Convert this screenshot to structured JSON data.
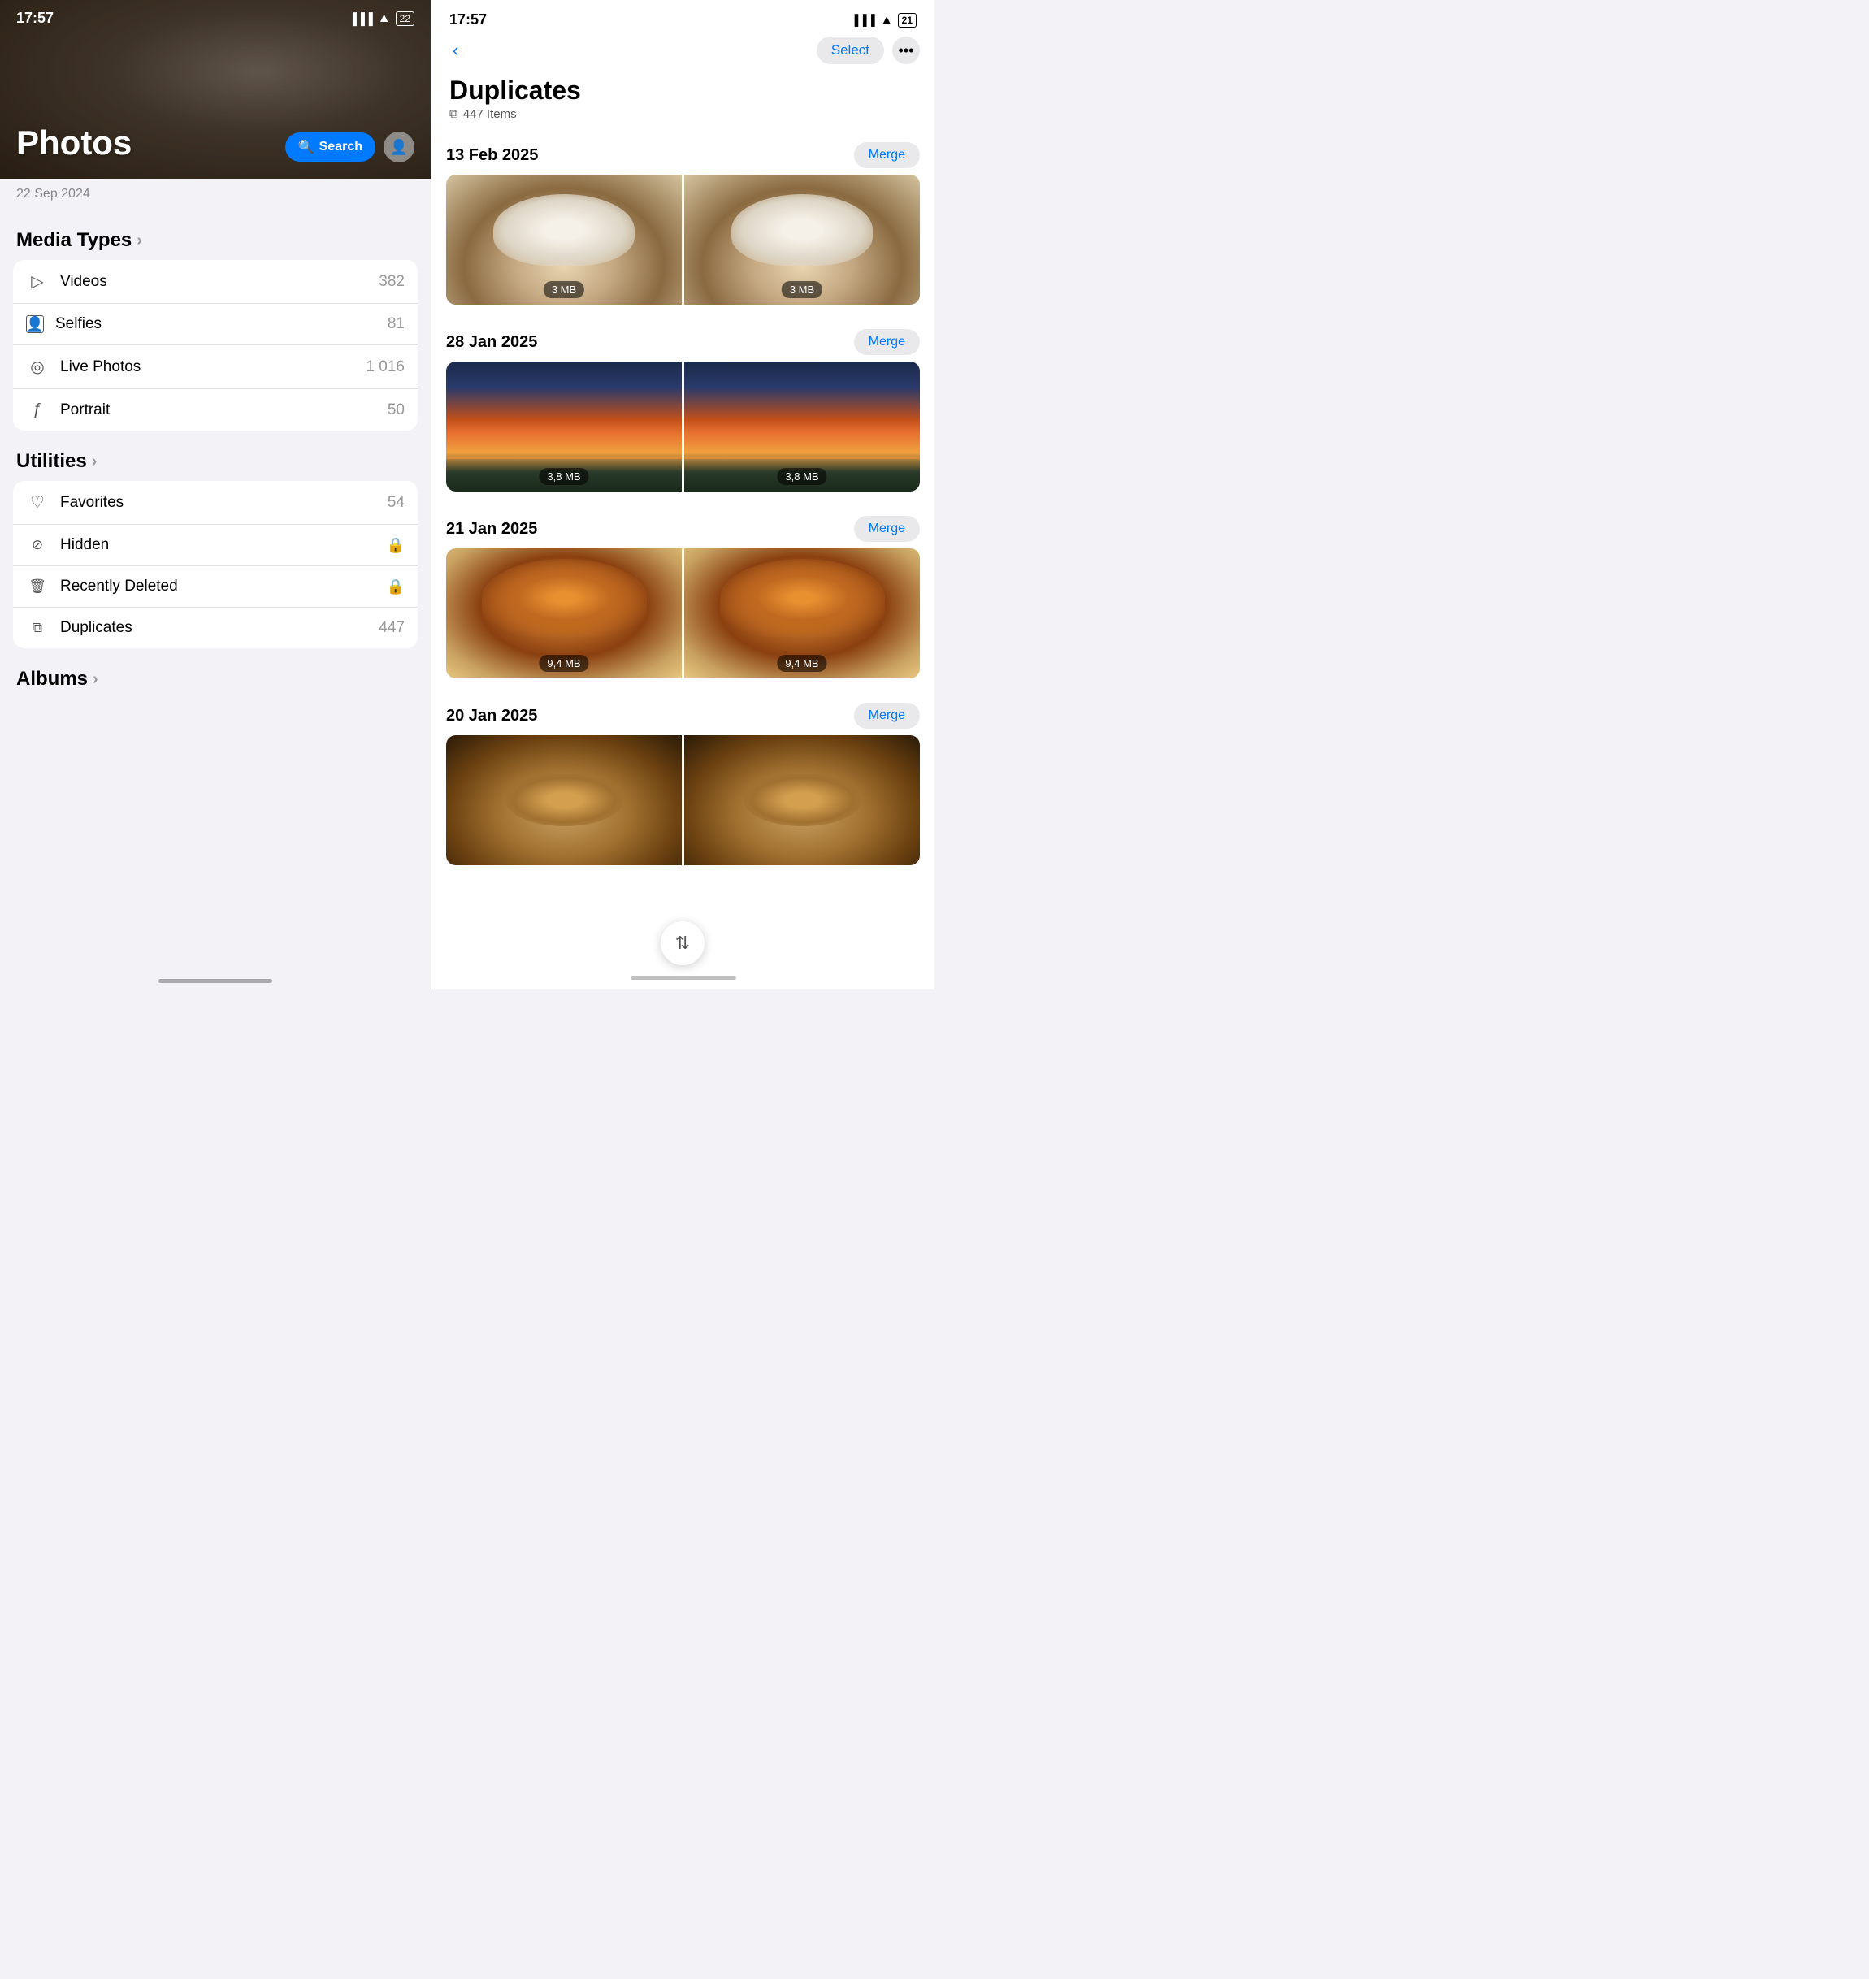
{
  "left": {
    "statusBar": {
      "time": "17:57"
    },
    "heroTitle": "Photos",
    "searchLabel": "Search",
    "dateLabel": "22 Sep 2024",
    "mediaTypes": {
      "header": "Media Types",
      "items": [
        {
          "icon": "video-icon",
          "iconChar": "▷",
          "label": "Videos",
          "value": "382"
        },
        {
          "icon": "selfie-icon",
          "iconChar": "⬜",
          "label": "Selfies",
          "value": "81"
        },
        {
          "icon": "livephoto-icon",
          "iconChar": "◎",
          "label": "Live Photos",
          "value": "1 016"
        },
        {
          "icon": "portrait-icon",
          "iconChar": "ƒ",
          "label": "Portrait",
          "value": "50"
        }
      ]
    },
    "utilities": {
      "header": "Utilities",
      "items": [
        {
          "icon": "favorites-icon",
          "iconChar": "♡",
          "label": "Favorites",
          "value": "54",
          "isLock": false
        },
        {
          "icon": "hidden-icon",
          "iconChar": "⊘",
          "label": "Hidden",
          "value": "",
          "isLock": true
        },
        {
          "icon": "deleted-icon",
          "iconChar": "🗑",
          "label": "Recently Deleted",
          "value": "",
          "isLock": true
        },
        {
          "icon": "duplicates-icon",
          "iconChar": "⧉",
          "label": "Duplicates",
          "value": "447",
          "isLock": false
        }
      ]
    },
    "albums": {
      "header": "Albums"
    }
  },
  "right": {
    "statusBar": {
      "time": "17:57"
    },
    "title": "Duplicates",
    "subtitle": "447 Items",
    "selectLabel": "Select",
    "sections": [
      {
        "date": "13 Feb 2025",
        "mergeLabel": "Merge",
        "photos": [
          {
            "size": "3 MB",
            "type": "cat-white"
          },
          {
            "size": "3 MB",
            "type": "cat-white"
          }
        ]
      },
      {
        "date": "28 Jan 2025",
        "mergeLabel": "Merge",
        "photos": [
          {
            "size": "3,8 MB",
            "type": "sunset"
          },
          {
            "size": "3,8 MB",
            "type": "sunset"
          }
        ]
      },
      {
        "date": "21 Jan 2025",
        "mergeLabel": "Merge",
        "photos": [
          {
            "size": "9,4 MB",
            "type": "cat-orange"
          },
          {
            "size": "9,4 MB",
            "type": "cat-orange"
          }
        ]
      },
      {
        "date": "20 Jan 2025",
        "mergeLabel": "Merge",
        "photos": [
          {
            "size": "",
            "type": "cat-bottom"
          },
          {
            "size": "",
            "type": "cat-bottom"
          }
        ]
      }
    ],
    "sortFabIcon": "⇅"
  }
}
